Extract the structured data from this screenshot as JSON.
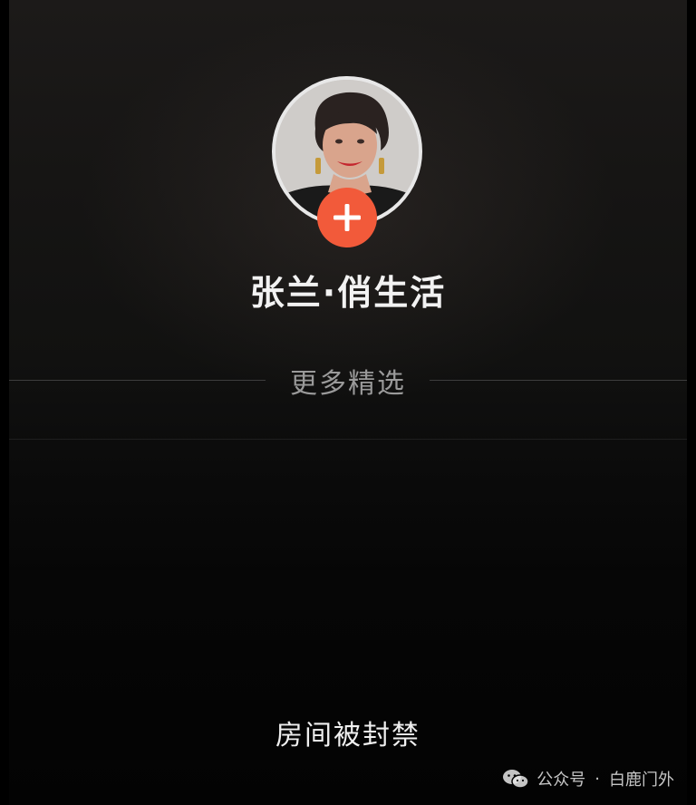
{
  "profile": {
    "name": "张兰·俏生活",
    "avatar_icon": "avatar-portrait",
    "follow_icon": "plus-icon",
    "follow_color": "#f25a3a"
  },
  "section": {
    "more_picks": "更多精选"
  },
  "status": {
    "room_banned": "房间被封禁"
  },
  "watermark": {
    "icon": "wechat-icon",
    "channel": "公众号",
    "separator": "·",
    "account": "白鹿门外"
  }
}
